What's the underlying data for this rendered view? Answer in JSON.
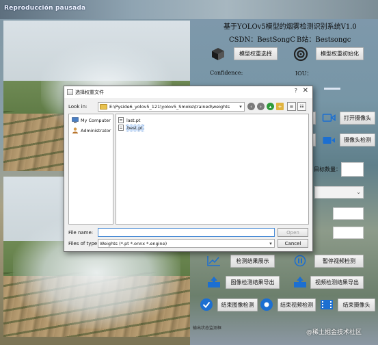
{
  "overlay": {
    "video_label": "Reproducción pausada"
  },
  "header": {
    "title": "基于YOLOv5模型的烟雾检测识别系统V1.0",
    "csdn": "CSDN：BestSongC",
    "bilibili": "B站：Bestsongc"
  },
  "controls": {
    "model_select": "模型权重选择",
    "model_init": "模型权重初始化",
    "confidence_label": "Confidence:",
    "iou_label": "IOU：",
    "open_camera": "打开摄像头",
    "camera_detect": "摄像头检测",
    "target_count_label": "目标数量：",
    "detect_result_show": "检测结果展示",
    "pause_video": "暂停视频检测",
    "image_export": "图像检测结果导出",
    "video_export": "视频检测结果导出",
    "end_image": "结束图像检测",
    "end_video": "结束视频检测",
    "end_camera": "结束摄像头"
  },
  "status": {
    "text": "输出状态监测框"
  },
  "watermark": "@稀土掘金技术社区",
  "dialog": {
    "title": "选择权重文件",
    "look_in_label": "Look in:",
    "look_in_path": "E:\\Pyside6_yolov5_121\\yolov5_Smoke\\trained\\weights",
    "help": "?",
    "close": "✕",
    "sidebar": [
      {
        "label": "My Computer"
      },
      {
        "label": "Administrator"
      }
    ],
    "files": [
      {
        "name": "last.pt"
      },
      {
        "name": "best.pt"
      }
    ],
    "file_name_label": "File name:",
    "file_name_value": "",
    "file_type_label": "Files of type:",
    "file_type_value": "Weights (*.pt *.onnx *.engine)",
    "open_button": "Open",
    "cancel_button": "Cancel"
  },
  "colors": {
    "accent_blue": "#1c6fd1",
    "selected_file": "#d6e8ff"
  }
}
